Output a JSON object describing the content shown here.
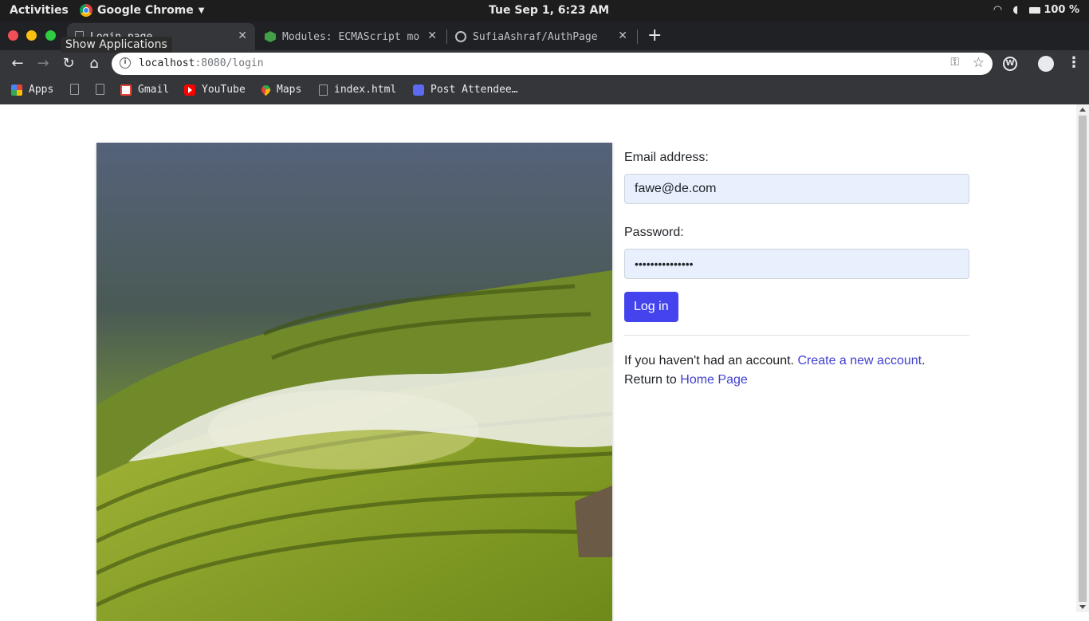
{
  "desktop": {
    "activities": "Activities",
    "app_name": "Google Chrome",
    "clock": "Tue Sep  1,  6:23 AM",
    "battery": "100 %",
    "tooltip": "Show Applications"
  },
  "browser": {
    "tabs": [
      {
        "label": "Login page",
        "active": true
      },
      {
        "label": "Modules: ECMAScript mo",
        "active": false
      },
      {
        "label": "SufiaAshraf/AuthPage",
        "active": false
      }
    ],
    "url_host": "localhost",
    "url_rest": ":8080/login",
    "bookmarks": [
      {
        "label": "Apps",
        "icon": "apps-grid-icon"
      },
      {
        "label": "",
        "icon": "page-icon"
      },
      {
        "label": "",
        "icon": "page-icon"
      },
      {
        "label": "Gmail",
        "icon": "gmail-icon"
      },
      {
        "label": "YouTube",
        "icon": "youtube-icon"
      },
      {
        "label": "Maps",
        "icon": "maps-icon"
      },
      {
        "label": "index.html",
        "icon": "page-icon"
      },
      {
        "label": "Post Attendee…",
        "icon": "zoom-icon"
      }
    ]
  },
  "login": {
    "email_label": "Email address:",
    "email_value": "fawe@de.com",
    "password_label": "Password:",
    "password_value": "•••••••••••••••",
    "submit_label": "Log in",
    "no_account_text": "If you haven't had an account.",
    "create_link": "Create a new account",
    "period": ".",
    "return_text": "Return to",
    "home_link": "Home Page"
  },
  "colors": {
    "button_bg": "#4444ee",
    "link": "#3f3fd0",
    "input_autofill_bg": "#e8f0fe"
  }
}
